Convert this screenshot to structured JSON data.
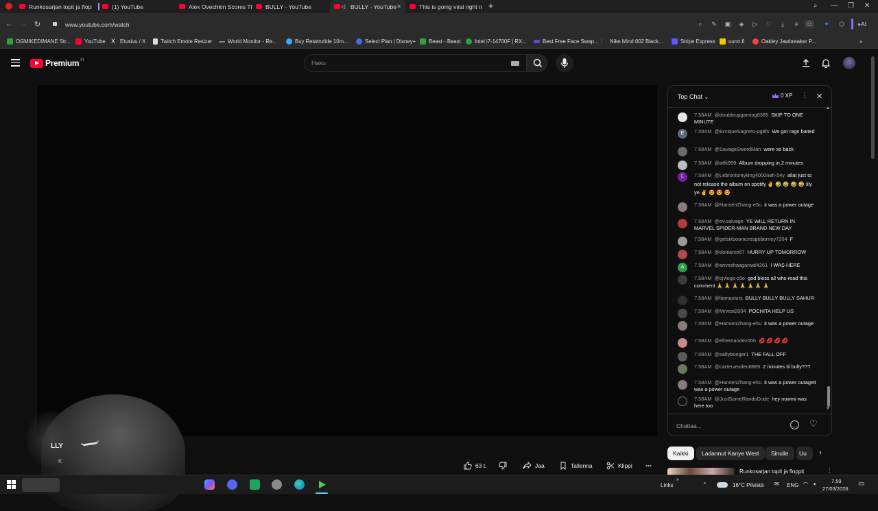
{
  "browser": {
    "tabs": [
      {
        "label": "Runkosarjan topit ja flopit"
      },
      {
        "label": "(1) YouTube"
      },
      {
        "label": "Alex Ovechkin Scores Thre"
      },
      {
        "label": "BULLY - YouTube"
      },
      {
        "label": "BULLY - YouTube"
      },
      {
        "label": "This is going viral right no"
      }
    ],
    "new_tab": "+",
    "url": "www.youtube.com/watch",
    "bookmarks": [
      {
        "label": "OGMIKEDIMANE Str...",
        "color": "#2ea043"
      },
      {
        "label": "YouTube",
        "color": "#ff0033"
      },
      {
        "label": "Etusivu / X",
        "color": "#ffffff"
      },
      {
        "label": "Twitch Emote Resizer",
        "color": "#dddddd"
      },
      {
        "label": "World Monitor - Re...",
        "color": "#888888"
      },
      {
        "label": "Buy Retatrutide 10m...",
        "color": "#3aa7ff"
      },
      {
        "label": "Select Plan | Disney+",
        "color": "#4b6bdc"
      },
      {
        "label": "Beast - Beast",
        "color": "#2ea043"
      },
      {
        "label": "Intel i7-14700F | RX...",
        "color": "#2ea043"
      },
      {
        "label": "Best Free Face Swap...",
        "color": "#5c4dd8"
      },
      {
        "label": "Nike Mind 002 Black...",
        "color": "#e33"
      },
      {
        "label": "Stripe Express",
        "color": "#6356ff"
      },
      {
        "label": "uuno.fi",
        "color": "#f5c400"
      },
      {
        "label": "Oakley Jawbreaker P...",
        "color": "#e44"
      }
    ],
    "extension_label": "AI"
  },
  "youtube": {
    "logo_text": "Premium",
    "logo_sup": "FI",
    "search_placeholder": "Haku"
  },
  "overlay": {
    "title_fragment": "LLY",
    "sub_fragment": "K"
  },
  "actions": {
    "likes": "63 t.",
    "share": "Jaa",
    "save": "Tallenna",
    "clip": "Klippi",
    "more": "..."
  },
  "chat": {
    "title": "Top Chat",
    "xp": "0 XP",
    "input_placeholder": "Chattaa...",
    "messages": [
      {
        "time": "7.58AM",
        "author": "@doubleupgaming8385",
        "text": "SKIP TO ONE MINUTE",
        "avatar": "",
        "avatar_color": "#e6e6e6"
      },
      {
        "time": "7.58AM",
        "author": "@EnriqueSagrero-pg8fs",
        "text": "We got rage baited",
        "avatar": "E",
        "avatar_color": "#5f6b7a"
      },
      {
        "time": "7.58AM",
        "author": "@SavageSwordMan",
        "text": "were so back",
        "avatar": "",
        "avatar_color": "#6a6a6a"
      },
      {
        "time": "7.58AM",
        "author": "@atfk999",
        "text": "Album dropping in 2 minutes",
        "avatar": "",
        "avatar_color": "#bdbdbd"
      },
      {
        "time": "7.58AM",
        "author": "@Lebronlsmyking4000nah-54y",
        "text": "allat just to not release the album on spotify ✌️ 🤣 🤣 🤣 🤣 lily ye ✌️ 😍 😍 😍",
        "avatar": "L",
        "avatar_color": "#7b1fa2"
      },
      {
        "time": "7.58AM",
        "author": "@HansenZhang-e5u",
        "text": "it was a power outage",
        "avatar": "",
        "avatar_color": "#8a7a7a"
      },
      {
        "time": "7.58AM",
        "author": "@ov.salvage",
        "text": "YE WILL RETURN IN MARVEL SPIDER-MAN BRAND NEW DAY",
        "avatar": "",
        "avatar_color": "#b23b3b"
      },
      {
        "time": "7.58AM",
        "author": "@gelsixboomcrespoberney7204",
        "text": "F",
        "avatar": "",
        "avatar_color": "#9a9a9a"
      },
      {
        "time": "7.58AM",
        "author": "@doriiarxo67",
        "text": "HURRY UP TOMORROW",
        "avatar": "",
        "avatar_color": "#b3474f"
      },
      {
        "time": "7.58AM",
        "author": "@anveshaagarwal4261",
        "text": "I WAS HERE",
        "avatar": "A",
        "avatar_color": "#2e9e4f"
      },
      {
        "time": "7.58AM",
        "author": "@cjvlogs-c6e",
        "text": "god bless all who read this comment 🙏 🙏 🙏 🙏 🙏 🙏 🙏",
        "avatar": "",
        "avatar_color": "#3c3c3c"
      },
      {
        "time": "7.58AM",
        "author": "@liamasturs",
        "text": "BULLY BULLY BULLY SAHUR",
        "avatar": "",
        "avatar_color": "#2f2f2f"
      },
      {
        "time": "7.58AM",
        "author": "@Mrvest2004",
        "text": "POCHITA HELP US",
        "avatar": "",
        "avatar_color": "#4a4a4a"
      },
      {
        "time": "7.58AM",
        "author": "@HansenZhang-e5u",
        "text": "it was a power outage",
        "avatar": "",
        "avatar_color": "#8a7a7a"
      },
      {
        "time": "7.58AM",
        "author": "@elhernandez006",
        "text": "💋 💋 💋 💋",
        "avatar": "",
        "avatar_color": "#c88a8a"
      },
      {
        "time": "7.58AM",
        "author": "@saltybooger1",
        "text": "THE FALL OFF",
        "avatar": "",
        "avatar_color": "#5a5a5a"
      },
      {
        "time": "7.58AM",
        "author": "@cartervexden8889",
        "text": "2 minutes til bully???",
        "avatar": "",
        "avatar_color": "#6a7a5a"
      },
      {
        "time": "7.58AM",
        "author": "@HansenZhang-e5u",
        "text": "it was a power outageit was a power outage",
        "avatar": "",
        "avatar_color": "#8a7a7a"
      },
      {
        "time": "7.58AM",
        "author": "@JustSomeRandoDude",
        "text": "hey nowmi was here too",
        "avatar": "",
        "avatar_color": "#111111"
      }
    ]
  },
  "chips": [
    "Kaikki",
    "Ladannut Kanye West",
    "Sinulle",
    "Uu"
  ],
  "recommendation_title": "Runkosarjan topit ja floppit",
  "taskbar": {
    "links": "Links",
    "weather": "16°C Pilvistä",
    "lang": "ENG",
    "time": "7.59",
    "date": "27/03/2026"
  }
}
